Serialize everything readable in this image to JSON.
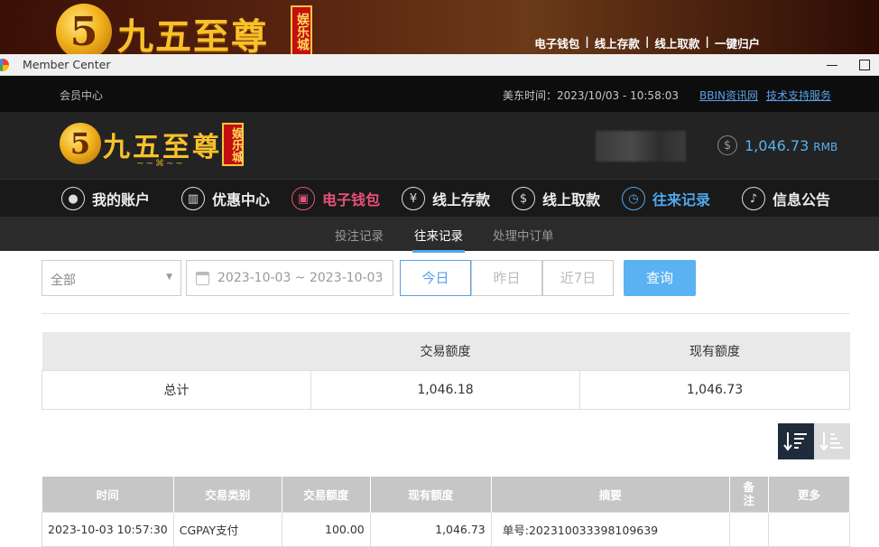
{
  "banner": {
    "logo_char": "5",
    "title": "九五至尊",
    "badge": "娱乐城",
    "nav": [
      "电子钱包",
      "线上存款",
      "线上取款",
      "一键归户"
    ]
  },
  "window": {
    "title": "Member Center"
  },
  "infobar": {
    "left": "会员中心",
    "time": "美东时间：2023/10/03 - 10:58:03",
    "links": [
      "BBIN资讯网",
      "技术支持服务"
    ]
  },
  "header": {
    "logo_char": "5",
    "title": "九五至尊",
    "badge": "娱乐城",
    "balance": "1,046.73",
    "currency": "RMB"
  },
  "mainnav": [
    {
      "label": "我的账户",
      "icon": "user-icon"
    },
    {
      "label": "优惠中心",
      "icon": "gift-icon"
    },
    {
      "label": "电子钱包",
      "icon": "wallet-icon"
    },
    {
      "label": "线上存款",
      "icon": "deposit-icon"
    },
    {
      "label": "线上取款",
      "icon": "withdraw-icon"
    },
    {
      "label": "往来记录",
      "icon": "records-icon"
    },
    {
      "label": "信息公告",
      "icon": "bell-icon"
    }
  ],
  "subtabs": [
    "投注记录",
    "往来记录",
    "处理中订单"
  ],
  "filters": {
    "type": "全部",
    "date_range": "2023-10-03 ~ 2023-10-03",
    "quick": [
      "今日",
      "昨日",
      "近7日"
    ],
    "query": "查询"
  },
  "summary": {
    "headers": [
      "",
      "交易额度",
      "现有额度"
    ],
    "row": [
      "总计",
      "1,046.18",
      "1,046.73"
    ]
  },
  "table": {
    "headers": [
      "时间",
      "交易类别",
      "交易额度",
      "现有额度",
      "摘要",
      "备注",
      "更多"
    ],
    "rows": [
      [
        "2023-10-03 10:57:30",
        "CGPAY支付",
        "100.00",
        "1,046.73",
        "单号:202310033398109639",
        "",
        ""
      ]
    ]
  },
  "colors": {
    "accent": "#4ea8ee",
    "wallet": "#e8517a",
    "gold": "#f7c12a"
  }
}
